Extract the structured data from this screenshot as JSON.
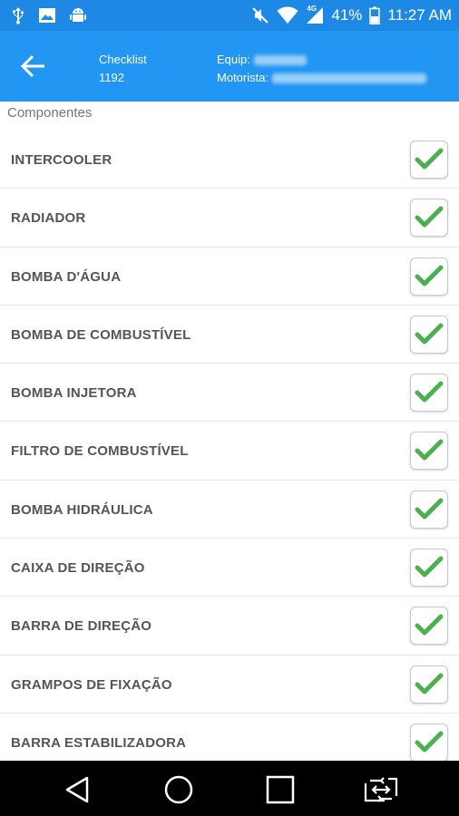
{
  "status_bar": {
    "icons_left": [
      "usb-icon",
      "image-icon",
      "android-icon"
    ],
    "icons_right": [
      "mute-icon",
      "wifi-icon",
      "signal-4g-icon",
      "battery-icon"
    ],
    "network": "4G",
    "battery": "41%",
    "time": "11:27 AM",
    "colors": {
      "status_bg": "#1e88e5"
    }
  },
  "app_bar": {
    "back_icon": "arrow-back-icon",
    "checklist_label": "Checklist",
    "checklist_number": "1192",
    "equip_label": "Equip:",
    "motorista_label": "Motorista:",
    "colors": {
      "bar_bg": "#2196f3"
    }
  },
  "section": {
    "label": "Componentes"
  },
  "components": [
    {
      "label": "INTERCOOLER",
      "checked": true
    },
    {
      "label": "RADIADOR",
      "checked": true
    },
    {
      "label": "BOMBA D'ÁGUA",
      "checked": true
    },
    {
      "label": "BOMBA DE COMBUSTÍVEL",
      "checked": true
    },
    {
      "label": "BOMBA INJETORA",
      "checked": true
    },
    {
      "label": "FILTRO DE COMBUSTÍVEL",
      "checked": true
    },
    {
      "label": "BOMBA HIDRÁULICA",
      "checked": true
    },
    {
      "label": "CAIXA DE DIREÇÃO",
      "checked": true
    },
    {
      "label": "BARRA DE DIREÇÃO",
      "checked": true
    },
    {
      "label": "GRAMPOS DE FIXAÇÃO",
      "checked": true
    },
    {
      "label": "BARRA ESTABILIZADORA",
      "checked": true
    }
  ],
  "nav_bar": {
    "buttons": [
      "back-triangle-icon",
      "home-circle-icon",
      "recents-square-icon",
      "switch-app-icon"
    ]
  },
  "colors": {
    "check_green": "#4caf50",
    "label_gray": "#555555"
  }
}
